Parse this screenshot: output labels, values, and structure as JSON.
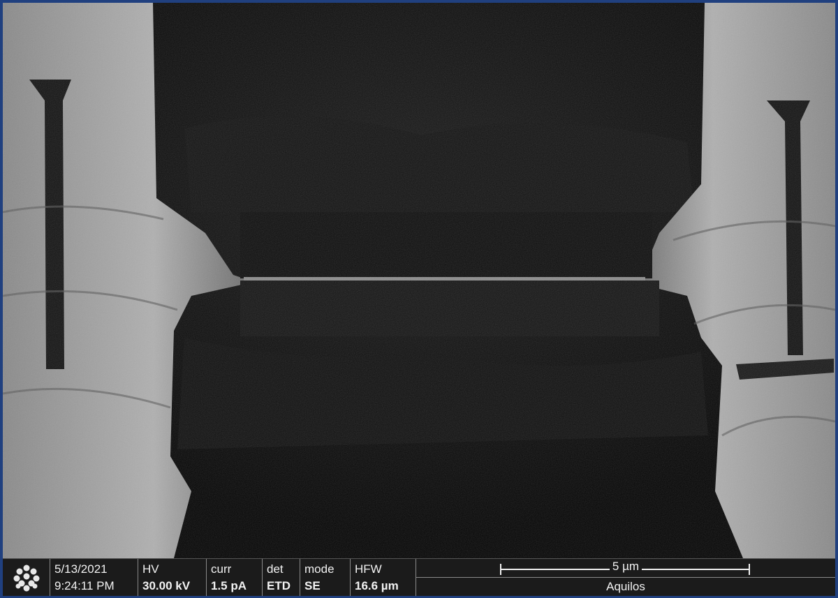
{
  "image": {
    "description_icon": "sem-micrograph"
  },
  "databar": {
    "logo_icon": "fei-logo-icon",
    "date": "5/13/2021",
    "time": "9:24:11 PM",
    "hv_label": "HV",
    "hv_value": "30.00 kV",
    "curr_label": "curr",
    "curr_value": "1.5 pA",
    "det_label": "det",
    "det_value": "ETD",
    "mode_label": "mode",
    "mode_value": "SE",
    "hfw_label": "HFW",
    "hfw_value": "16.6 µm",
    "scale_label": "5 µm",
    "instrument": "Aquilos"
  },
  "colors": {
    "frame": "#20407f",
    "bar_bg": "#1b1b1b",
    "text": "#f2f2f2"
  }
}
